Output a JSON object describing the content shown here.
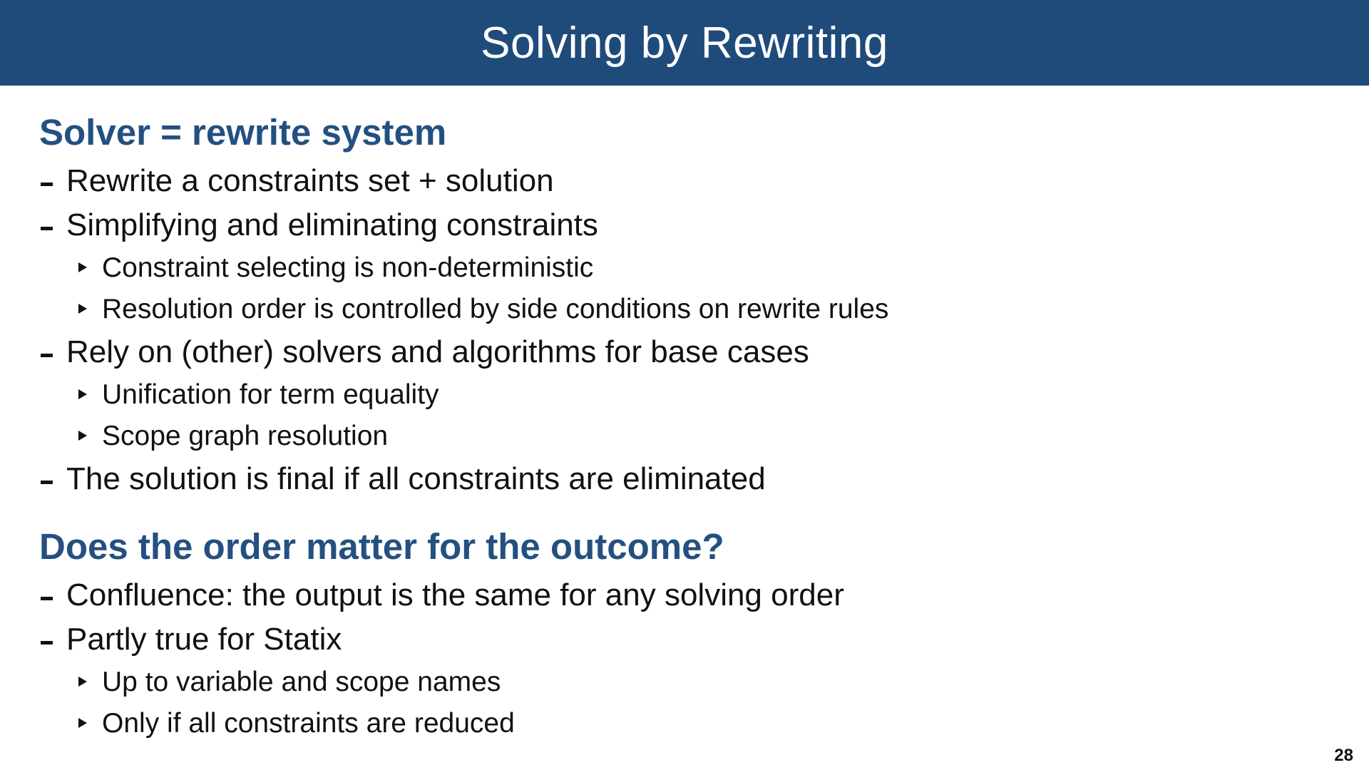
{
  "slide": {
    "title": "Solving by Rewriting",
    "page_number": "28",
    "sections": [
      {
        "heading": "Solver = rewrite system",
        "items": [
          {
            "text": "Rewrite a constraints set + solution",
            "sub": []
          },
          {
            "text": "Simplifying and eliminating constraints",
            "sub": [
              "Constraint selecting is non-deterministic",
              "Resolution order is controlled by side conditions on rewrite rules"
            ]
          },
          {
            "text": "Rely on (other) solvers and algorithms for base cases",
            "sub": [
              "Unification for term equality",
              "Scope graph resolution"
            ]
          },
          {
            "text": "The solution is final if all constraints are eliminated",
            "sub": []
          }
        ]
      },
      {
        "heading": "Does the order matter for the outcome?",
        "items": [
          {
            "text": "Confluence: the output is the same for any solving order",
            "sub": []
          },
          {
            "text": "Partly true for Statix",
            "sub": [
              "Up to variable and scope names",
              "Only if all constraints are reduced"
            ]
          }
        ]
      }
    ]
  },
  "colors": {
    "title_bar": "#1f4b7b",
    "heading": "#245081",
    "text": "#111111"
  }
}
